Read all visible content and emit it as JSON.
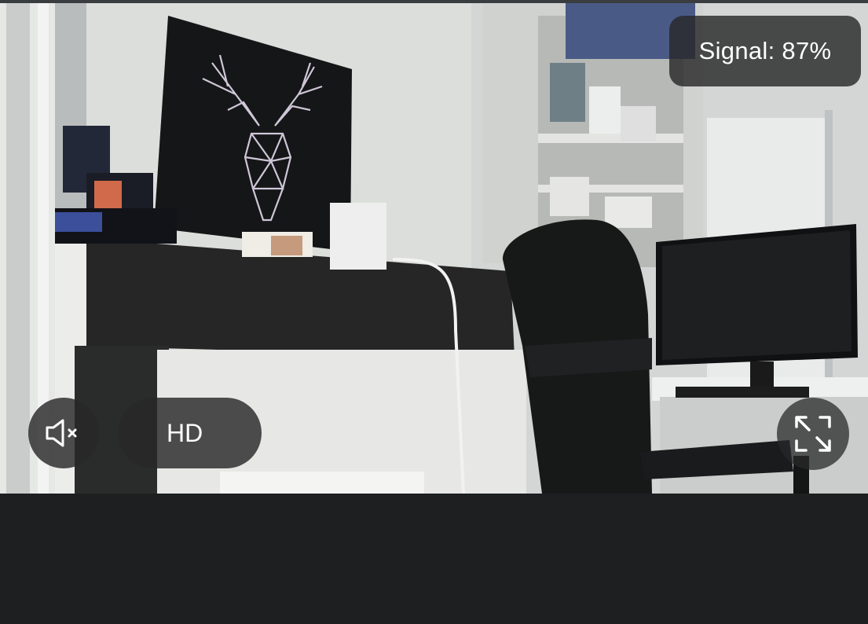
{
  "video": {
    "signal_label": "Signal: 87%"
  },
  "controls": {
    "mute_icon": "speaker-muted-icon",
    "quality_label": "HD",
    "fullscreen_icon": "expand-icon"
  },
  "colors": {
    "overlay": "#28282a",
    "panel": "#1e1f21",
    "text": "#ffffff"
  }
}
